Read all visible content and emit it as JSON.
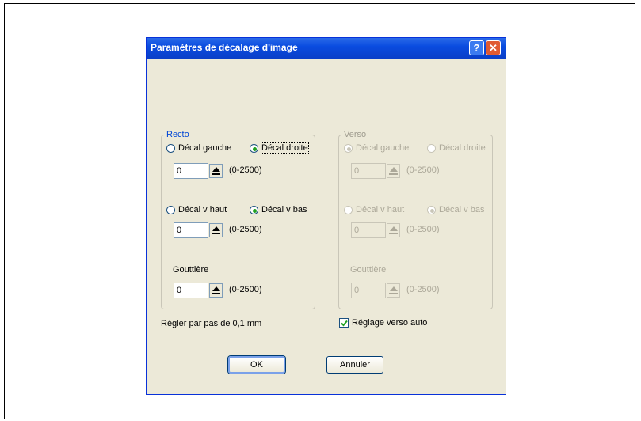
{
  "dialog": {
    "title": "Paramètres de décalage d'image",
    "help_label": "?",
    "close_label": "✕"
  },
  "recto": {
    "legend": "Recto",
    "options": [
      {
        "label": "Décal gauche",
        "selected": false
      },
      {
        "label": "Décal droite",
        "selected": true
      },
      {
        "label": "Décal v haut",
        "selected": false
      },
      {
        "label": "Décal v bas",
        "selected": true
      }
    ],
    "horizontal_value": "0",
    "vertical_value": "0",
    "gutter_label": "Gouttière",
    "gutter_value": "0",
    "range": "(0-2500)"
  },
  "verso": {
    "legend": "Verso",
    "enabled": false,
    "options": [
      {
        "label": "Décal gauche",
        "selected": true
      },
      {
        "label": "Décal droite",
        "selected": false
      },
      {
        "label": "Décal v haut",
        "selected": false
      },
      {
        "label": "Décal v bas",
        "selected": true
      }
    ],
    "horizontal_value": "0",
    "vertical_value": "0",
    "gutter_label": "Gouttière",
    "gutter_value": "0",
    "range": "(0-2500)"
  },
  "step_note": "Régler par pas de 0,1 mm",
  "auto_verso": {
    "label": "Réglage verso auto",
    "checked": true
  },
  "buttons": {
    "ok": "OK",
    "cancel": "Annuler"
  },
  "colors": {
    "title_bar": "#0a4ce0",
    "dialog_bg": "#ece9d8",
    "group_title": "#0046d5",
    "radio_dot": "#21a121"
  }
}
